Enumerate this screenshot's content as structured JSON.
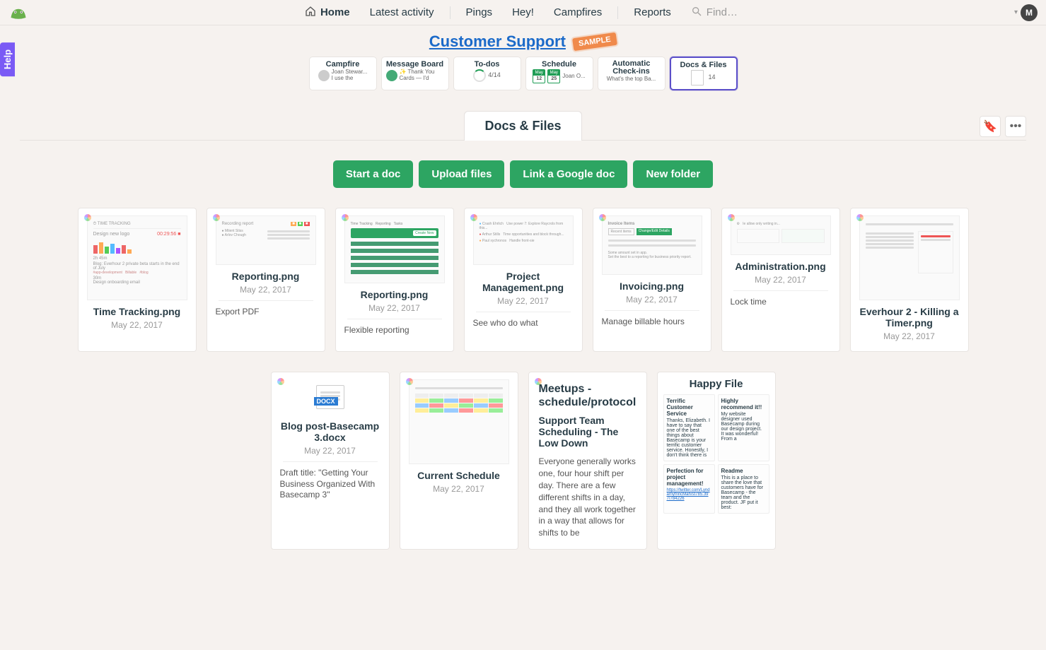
{
  "nav": {
    "home": "Home",
    "latest": "Latest activity",
    "pings": "Pings",
    "hey": "Hey!",
    "campfires": "Campfires",
    "reports": "Reports",
    "find": "Find…",
    "avatar_initial": "M"
  },
  "help_tab": "Help",
  "project": {
    "title": "Customer Support",
    "badge": "SAMPLE"
  },
  "tools": [
    {
      "title": "Campfire",
      "text": "Joan Stewar...\nI use the"
    },
    {
      "title": "Message Board",
      "text": "✨ Thank You Cards — I'd"
    },
    {
      "title": "To-dos",
      "text": "4/14"
    },
    {
      "title": "Schedule",
      "text": "Joan O...",
      "d1": {
        "m": "May",
        "d": "12"
      },
      "d2": {
        "m": "May",
        "d": "25"
      }
    },
    {
      "title": "Automatic Check-ins",
      "text": "What's the top Ba..."
    },
    {
      "title": "Docs & Files",
      "text": "14"
    }
  ],
  "section_title": "Docs & Files",
  "actions": {
    "start_doc": "Start a doc",
    "upload": "Upload files",
    "google": "Link a Google doc",
    "folder": "New folder"
  },
  "files": [
    {
      "name": "Time Tracking.png",
      "date": "May 22, 2017",
      "desc": null,
      "thumb": "time"
    },
    {
      "name": "Reporting.png",
      "date": "May 22, 2017",
      "desc": "Export PDF",
      "thumb": "report1"
    },
    {
      "name": "Reporting.png",
      "date": "May 22, 2017",
      "desc": "Flexible reporting",
      "thumb": "report2"
    },
    {
      "name": "Project Management.png",
      "date": "May 22, 2017",
      "desc": "See who do what",
      "thumb": "pm"
    },
    {
      "name": "Invoicing.png",
      "date": "May 22, 2017",
      "desc": "Manage billable hours",
      "thumb": "inv"
    },
    {
      "name": "Administration.png",
      "date": "May 22, 2017",
      "desc": "Lock time",
      "thumb": "admin"
    },
    {
      "name": "Everhour 2 - Killing a Timer.png",
      "date": "May 22, 2017",
      "desc": null,
      "thumb": "ever"
    },
    {
      "name": "Blog post-Basecamp 3.docx",
      "date": "May 22, 2017",
      "desc": "Draft title: \"Getting Your Business Organized With Basecamp 3\"",
      "thumb": "docx"
    },
    {
      "name": "Current Schedule",
      "date": "May 22, 2017",
      "desc": null,
      "thumb": "sched"
    }
  ],
  "note": {
    "title": "Meetups - schedule/protocol",
    "subtitle": "Support Team Scheduling - The Low Down",
    "body": "Everyone generally works one, four hour shift per day. There are a few different shifts in a day, and they all work together in a way that allows for shifts to be"
  },
  "folder": {
    "title": "Happy File",
    "items": [
      {
        "t": "Terrific Customer Service",
        "b": "Thanks, Elizabeth. I have to say that one of the best things about Basecamp is your terrific customer service. Honestly, I don't think there is"
      },
      {
        "t": "Highly recommend it!!",
        "b": "My website designer used Basecamp during our design project. It was wonderful! From a"
      },
      {
        "t": "Perfection for project management!",
        "b": "https://twitter.com/LyndamyfriricMah/st785.397/784226"
      },
      {
        "t": "Readme",
        "b": "This is a place to share the love that customers have for Basecamp - the team and the product.\nJF put it best:"
      }
    ]
  },
  "docx_label": "DOCX"
}
